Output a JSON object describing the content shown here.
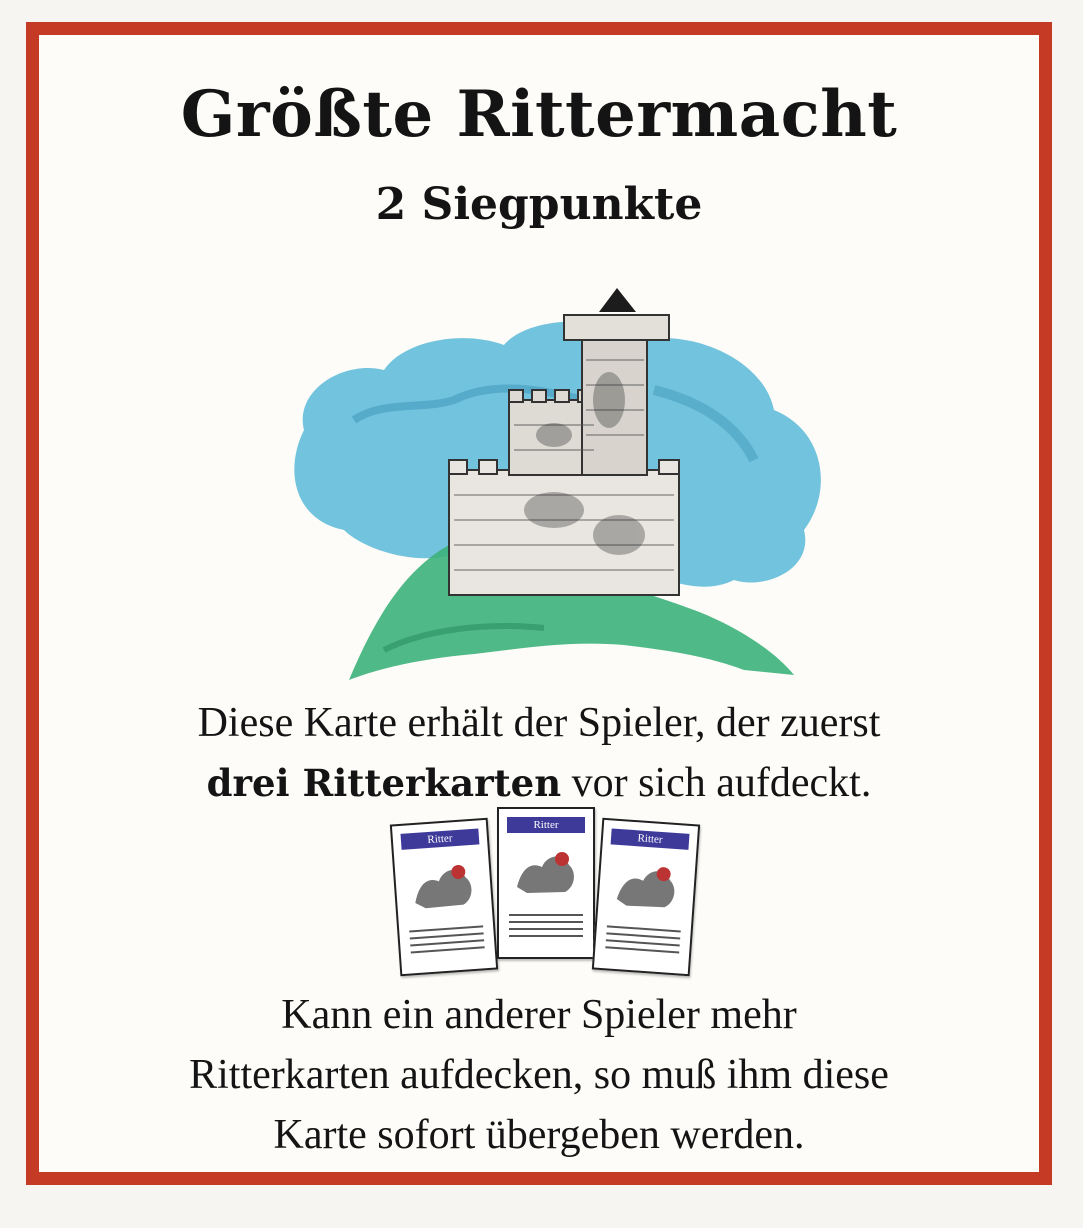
{
  "card": {
    "title": "Größte Rittermacht",
    "subtitle": "2 Siegpunkte",
    "rule_text": {
      "line1": "Diese Karte erhält der Spieler, der zuerst",
      "line2_bold": "drei Ritterkarten",
      "line2_rest": " vor sich aufdeckt."
    },
    "knight_card_label": "Ritter",
    "follow_text": {
      "line1": "Kann ein anderer Spieler mehr",
      "line2": "Ritterkarten aufdecken, so muß ihm diese",
      "line3": "Karte sofort übergeben werden."
    }
  },
  "colors": {
    "border": "#c43a24",
    "sky": "#59b8d8",
    "hill": "#3cb17a",
    "knight_card_bar": "#3e3a9a"
  },
  "icons": [
    "castle-tower-illustration",
    "knight-card-icon"
  ]
}
